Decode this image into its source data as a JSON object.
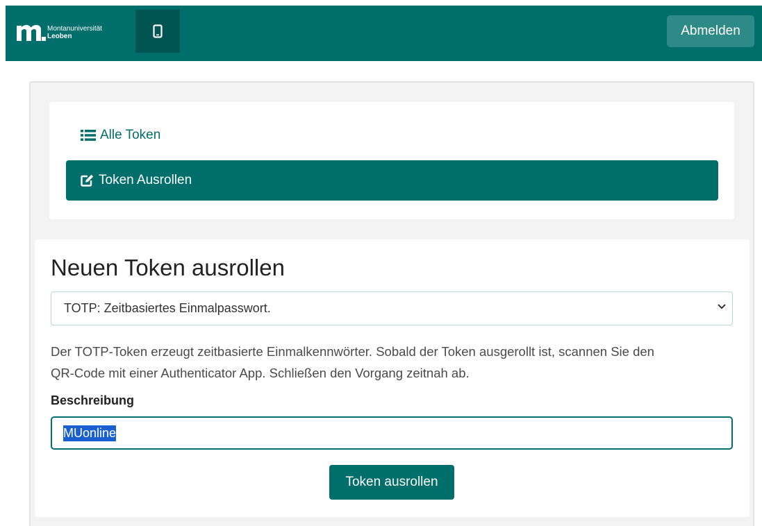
{
  "header": {
    "logo_line1": "Montanuniversität",
    "logo_line2": "Leoben",
    "logout_label": "Abmelden",
    "brand_color": "#006e6a"
  },
  "nav": {
    "all_tokens_label": "Alle Token",
    "all_tokens_icon": "list-icon",
    "enroll_label": "Token Ausrollen",
    "enroll_icon": "edit-icon"
  },
  "form": {
    "title": "Neuen Token ausrollen",
    "token_type_selected": "TOTP: Zeitbasiertes Einmalpasswort.",
    "description_line1": "Der TOTP-Token erzeugt zeitbasierte Einmalkennwörter. Sobald der Token ausgerollt ist, scannen Sie den",
    "description_line2": "QR-Code mit einer Authenticator App. Schließen den Vorgang zeitnah ab.",
    "field_label": "Beschreibung",
    "field_value": "MUonline",
    "submit_label": "Token ausrollen"
  }
}
